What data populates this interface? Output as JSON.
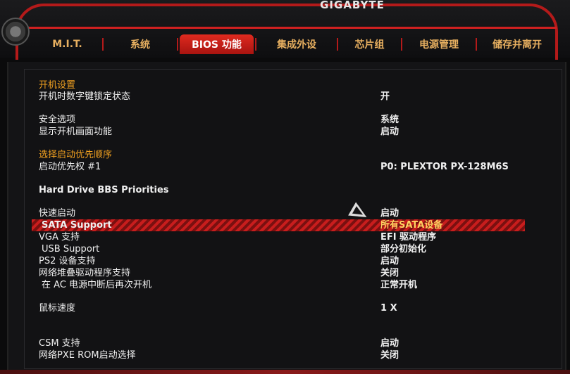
{
  "brand": "GIGABYTE",
  "tabs": [
    {
      "label": "M.I.T."
    },
    {
      "label": "系统"
    },
    {
      "label": "BIOS 功能"
    },
    {
      "label": "集成外设"
    },
    {
      "label": "芯片组"
    },
    {
      "label": "电源管理"
    },
    {
      "label": "储存并离开"
    }
  ],
  "active_tab": "BIOS 功能",
  "settings": [
    {
      "label": "开机设置",
      "value": ""
    },
    {
      "label": "开机时数字键锁定状态",
      "value": "开"
    },
    {
      "label": "安全选项",
      "value": "系统"
    },
    {
      "label": "显示开机画面功能",
      "value": "启动"
    },
    {
      "label": "选择启动优先顺序",
      "value": ""
    },
    {
      "label": "启动优先权 #1",
      "value": "P0: PLEXTOR PX-128M6S"
    },
    {
      "label": "Hard Drive BBS Priorities",
      "value": ""
    },
    {
      "label": "快速启动",
      "value": "启动"
    },
    {
      "label": "SATA Support",
      "value": "所有SATA设备"
    },
    {
      "label": "VGA 支持",
      "value": "EFI 驱动程序"
    },
    {
      "label": "USB Support",
      "value": "部分初始化"
    },
    {
      "label": "PS2 设备支持",
      "value": "启动"
    },
    {
      "label": "网络堆叠驱动程序支持",
      "value": "关闭"
    },
    {
      "label": "在 AC 电源中断后再次开机",
      "value": "正常开机"
    },
    {
      "label": "鼠标速度",
      "value": "1 X"
    },
    {
      "label": "CSM 支持",
      "value": "启动"
    },
    {
      "label": "网络PXE ROM启动选择",
      "value": "关闭"
    }
  ],
  "colors": {
    "accent_red": "#c81d1d",
    "heading_orange": "#f0a020",
    "tab_inactive": "#e8b060",
    "highlight_value": "#ffd060"
  }
}
